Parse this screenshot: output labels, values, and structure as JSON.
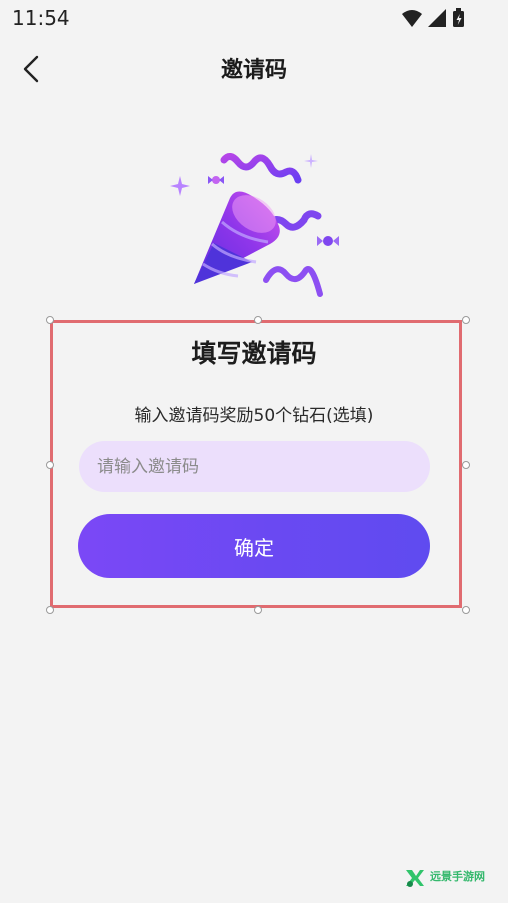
{
  "status_bar": {
    "time": "11:54",
    "icons": [
      "wifi-icon",
      "signal-icon",
      "battery-icon"
    ]
  },
  "header": {
    "title": "邀请码",
    "back_icon": "chevron-left-icon"
  },
  "hero": {
    "illustration": "party-popper-icon"
  },
  "card": {
    "title": "填写邀请码",
    "description": "输入邀请码奖励50个钻石(选填)",
    "input": {
      "value": "",
      "placeholder": "请输入邀请码"
    },
    "confirm_label": "确定"
  },
  "watermark": {
    "text": "远景手游网"
  },
  "colors": {
    "background": "#f3f3f3",
    "input_background": "#ecdffc",
    "button_gradient_start": "#7b48f6",
    "button_gradient_end": "#5f4bf0",
    "selection_border": "#e06b70"
  }
}
